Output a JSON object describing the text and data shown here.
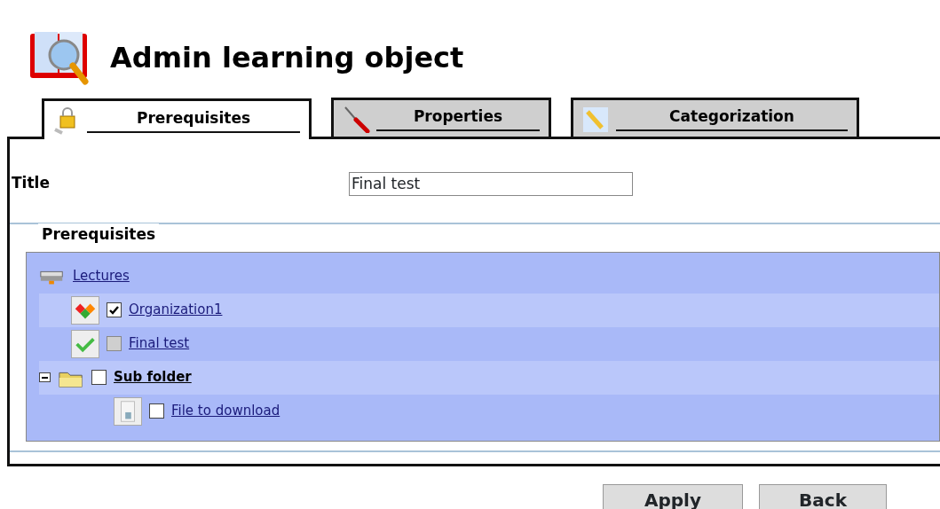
{
  "page": {
    "title": "Admin learning object"
  },
  "tabs": [
    {
      "label": "Prerequisites",
      "kind": "lock",
      "selected": true
    },
    {
      "label": "Properties",
      "kind": "screwdriver",
      "selected": false
    },
    {
      "label": "Categorization",
      "kind": "pencil",
      "selected": false
    }
  ],
  "form": {
    "title_label": "Title",
    "title_value": "Final test"
  },
  "prerequisites": {
    "legend": "Prerequisites",
    "tree": {
      "label": "Lectures",
      "kind": "root",
      "children": [
        {
          "label": "Organization1",
          "kind": "organization",
          "checked": true,
          "disabled": false
        },
        {
          "label": "Final test",
          "kind": "test",
          "checked": false,
          "disabled": true
        },
        {
          "label": "Sub folder",
          "kind": "folder",
          "checked": false,
          "disabled": false,
          "expanded": true,
          "children": [
            {
              "label": "File to download",
              "kind": "file",
              "checked": false,
              "disabled": false
            }
          ]
        }
      ]
    }
  },
  "buttons": [
    "Apply",
    "Back"
  ]
}
